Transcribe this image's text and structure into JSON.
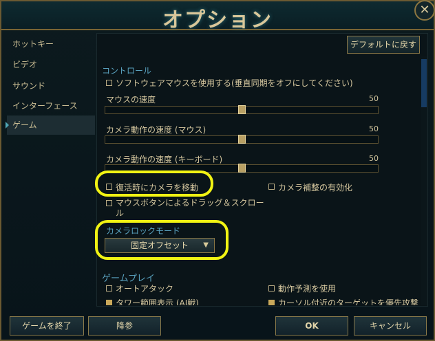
{
  "window": {
    "title": "オプション"
  },
  "sidebar": {
    "items": [
      {
        "label": "ホットキー",
        "active": false
      },
      {
        "label": "ビデオ",
        "active": false
      },
      {
        "label": "サウンド",
        "active": false
      },
      {
        "label": "インターフェース",
        "active": false
      },
      {
        "label": "ゲーム",
        "active": true
      }
    ]
  },
  "header": {
    "default_button": "デフォルトに戻す"
  },
  "controls": {
    "title": "コントロール",
    "software_mouse": {
      "label": "ソフトウェアマウスを使用する(垂直同期をオフにしてください)",
      "checked": false
    },
    "mouse_speed": {
      "label": "マウスの速度",
      "value": "50",
      "percent": 50
    },
    "camera_speed_mouse": {
      "label": "カメラ動作の速度 (マウス)",
      "value": "50",
      "percent": 50
    },
    "camera_speed_keyboard": {
      "label": "カメラ動作の速度 (キーボード)",
      "value": "50",
      "percent": 50
    },
    "move_camera_on_revive": {
      "label": "復活時にカメラを移動",
      "checked": false
    },
    "camera_smoothing": {
      "label": "カメラ補整の有効化",
      "checked": false
    },
    "mouse_button_drag_line1": "マウスボタンによるドラッグ＆スクロー",
    "mouse_button_drag_line2": "ル",
    "camera_lock_mode": {
      "label": "カメラロックモード",
      "selected": "固定オフセット"
    }
  },
  "gameplay": {
    "title": "ゲームプレイ",
    "auto_attack": {
      "label": "オートアタック",
      "checked": false
    },
    "movement_prediction": {
      "label": "動作予測を使用",
      "checked": false
    },
    "tower_range_label": "タワー範囲表示 (AI戦)",
    "cursor_target_label": "カーソル付近のターゲットを優先攻撃"
  },
  "footer": {
    "quit": "ゲームを終了",
    "surrender": "降参",
    "ok": "OK",
    "cancel": "キャンセル"
  },
  "colors": {
    "highlight": "#f1f313",
    "section": "#5aa3c0",
    "text": "#d4c69e"
  }
}
